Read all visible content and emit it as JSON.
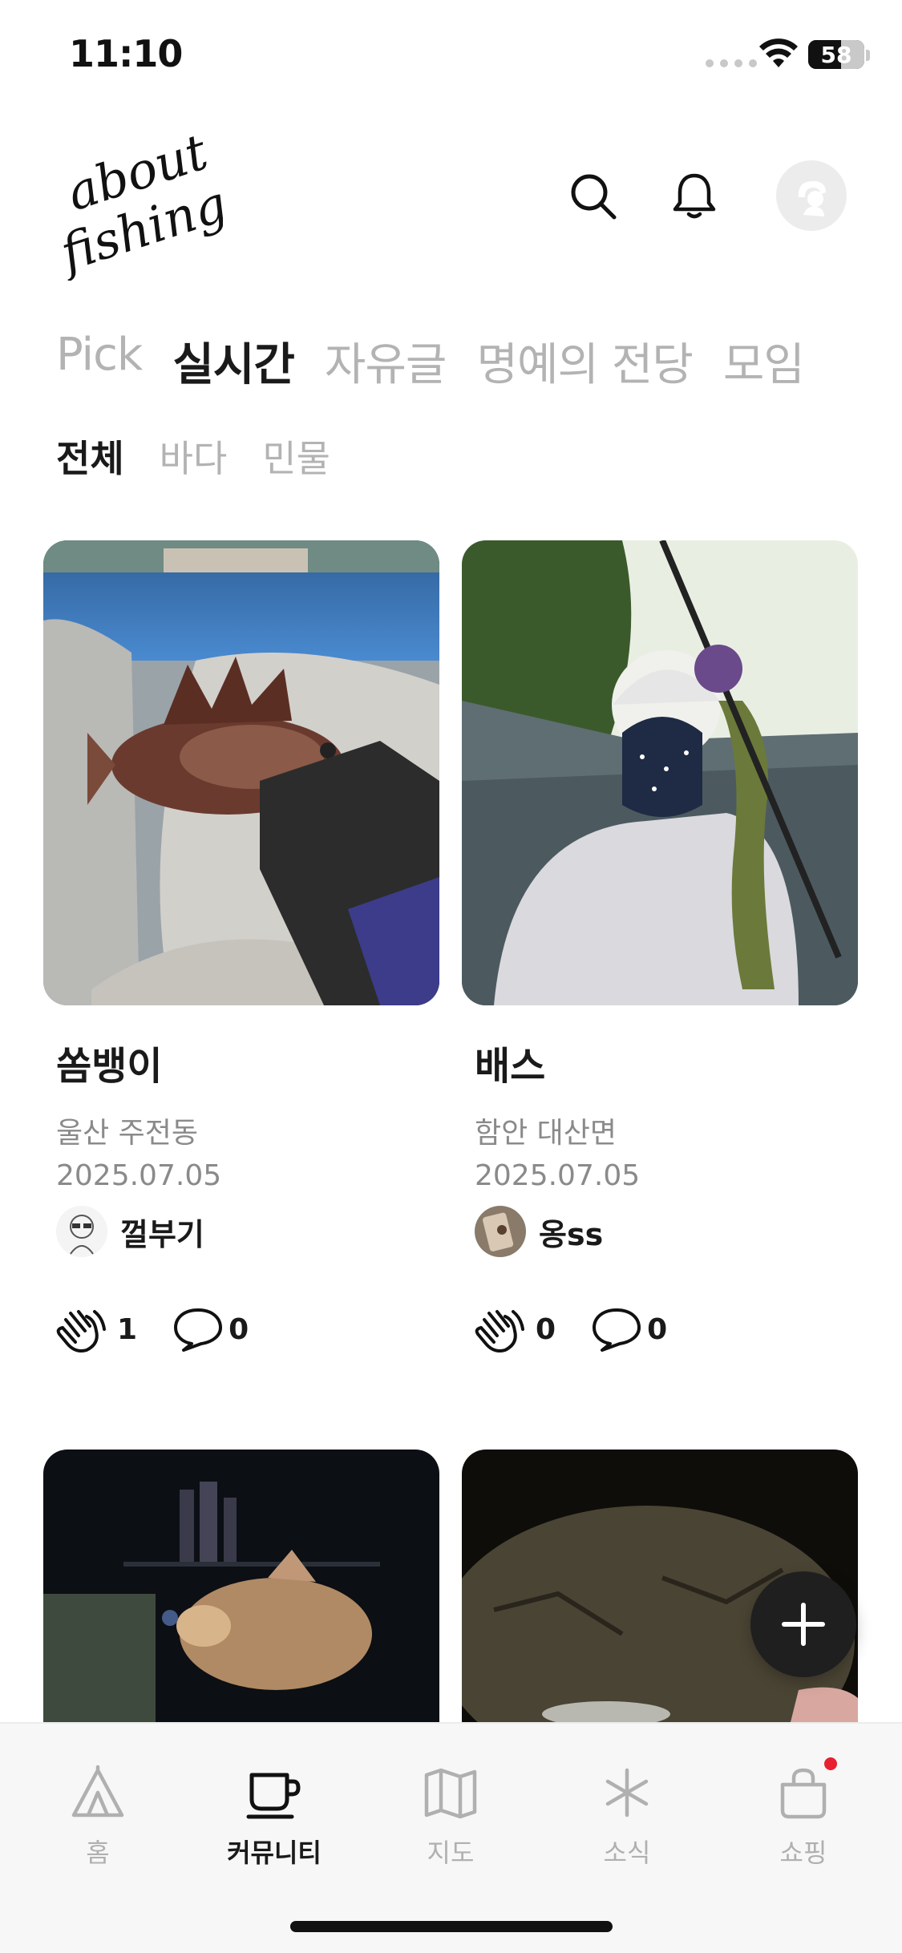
{
  "status_bar": {
    "time": "11:10",
    "battery_percent": "58"
  },
  "header": {
    "logo_line1": "about",
    "logo_line2": "fishing"
  },
  "main_tabs": [
    {
      "label": "Pick",
      "active": false
    },
    {
      "label": "실시간",
      "active": true
    },
    {
      "label": "자유글",
      "active": false
    },
    {
      "label": "명예의 전당",
      "active": false
    },
    {
      "label": "모임",
      "active": false
    }
  ],
  "sub_tabs": [
    {
      "label": "전체",
      "active": true
    },
    {
      "label": "바다",
      "active": false
    },
    {
      "label": "민물",
      "active": false
    }
  ],
  "posts": [
    {
      "title": "쏨뱅이",
      "location": "울산 주전동",
      "date": "2025.07.05",
      "author": "껄부기",
      "claps": "1",
      "comments": "0"
    },
    {
      "title": "배스",
      "location": "함안 대산면",
      "date": "2025.07.05",
      "author": "옹ss",
      "claps": "0",
      "comments": "0"
    }
  ],
  "bottom_nav": [
    {
      "label": "홈",
      "icon": "tent-icon",
      "active": false
    },
    {
      "label": "커뮤니티",
      "icon": "cup-icon",
      "active": true
    },
    {
      "label": "지도",
      "icon": "map-icon",
      "active": false
    },
    {
      "label": "소식",
      "icon": "asterisk-icon",
      "active": false
    },
    {
      "label": "쇼핑",
      "icon": "shopping-bag-icon",
      "active": false,
      "badge": true
    }
  ],
  "colors": {
    "accent": "#1a1a1a",
    "inactive": "#b3b3b3",
    "notification": "#e8202f"
  }
}
